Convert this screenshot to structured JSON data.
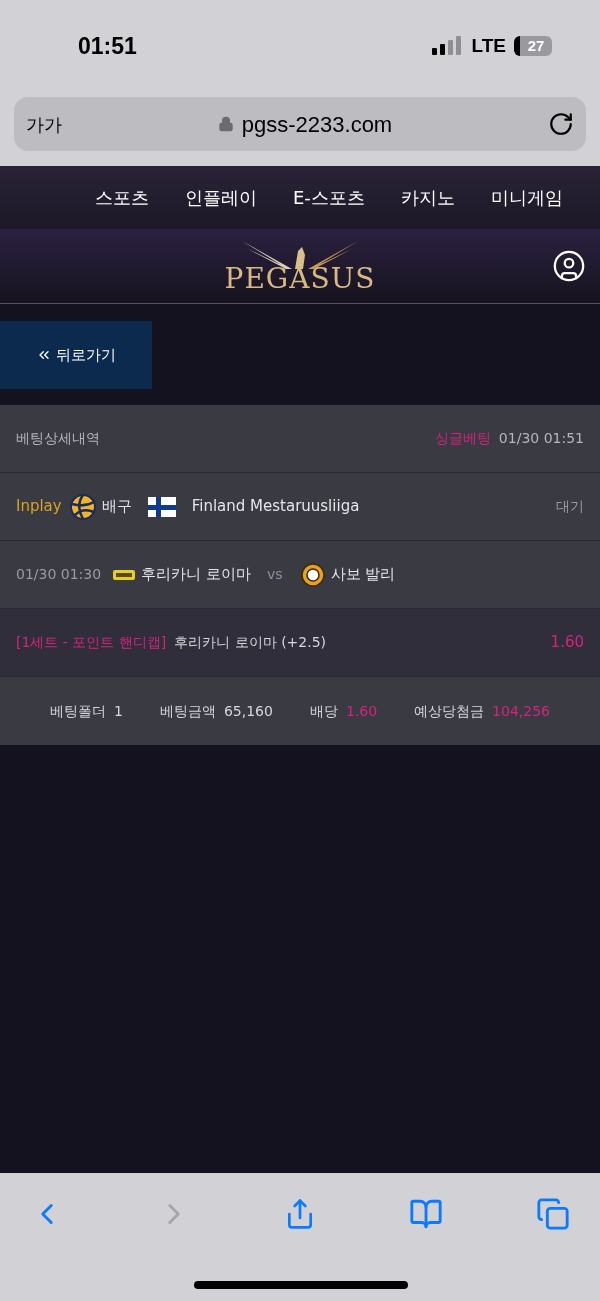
{
  "status_bar": {
    "time": "01:51",
    "network": "LTE",
    "battery": "27"
  },
  "browser": {
    "text_size": "가가",
    "url": "pgss-2233.com"
  },
  "nav": [
    {
      "label": "스포츠"
    },
    {
      "label": "인플레이"
    },
    {
      "label": "E-스포츠"
    },
    {
      "label": "카지노"
    },
    {
      "label": "미니게임"
    }
  ],
  "logo": "PEGASUS",
  "back_button": "뒤로가기",
  "detail": {
    "title": "베팅상세내역",
    "bet_type": "싱글베팅",
    "bet_time": "01/30 01:51",
    "game_type": "Inplay",
    "sport": "배구",
    "league": "Finland Mestaruusliiga",
    "status": "대기",
    "match_time": "01/30 01:30",
    "home": "후리카니 로이마",
    "vs": "vs",
    "away": "사보 발리",
    "market": "[1세트 - 포인트 핸디캡]",
    "pick": "후리카니 로이마 (+2.5)",
    "odds": "1.60",
    "summary": [
      {
        "label": "베팅폴더",
        "value": "1",
        "highlight": false
      },
      {
        "label": "베팅금액",
        "value": "65,160",
        "highlight": false
      },
      {
        "label": "배당",
        "value": "1.60",
        "highlight": true
      },
      {
        "label": "예상당첨금",
        "value": "104,256",
        "highlight": true
      }
    ]
  },
  "toolbar": {
    "forward_disabled": true
  }
}
